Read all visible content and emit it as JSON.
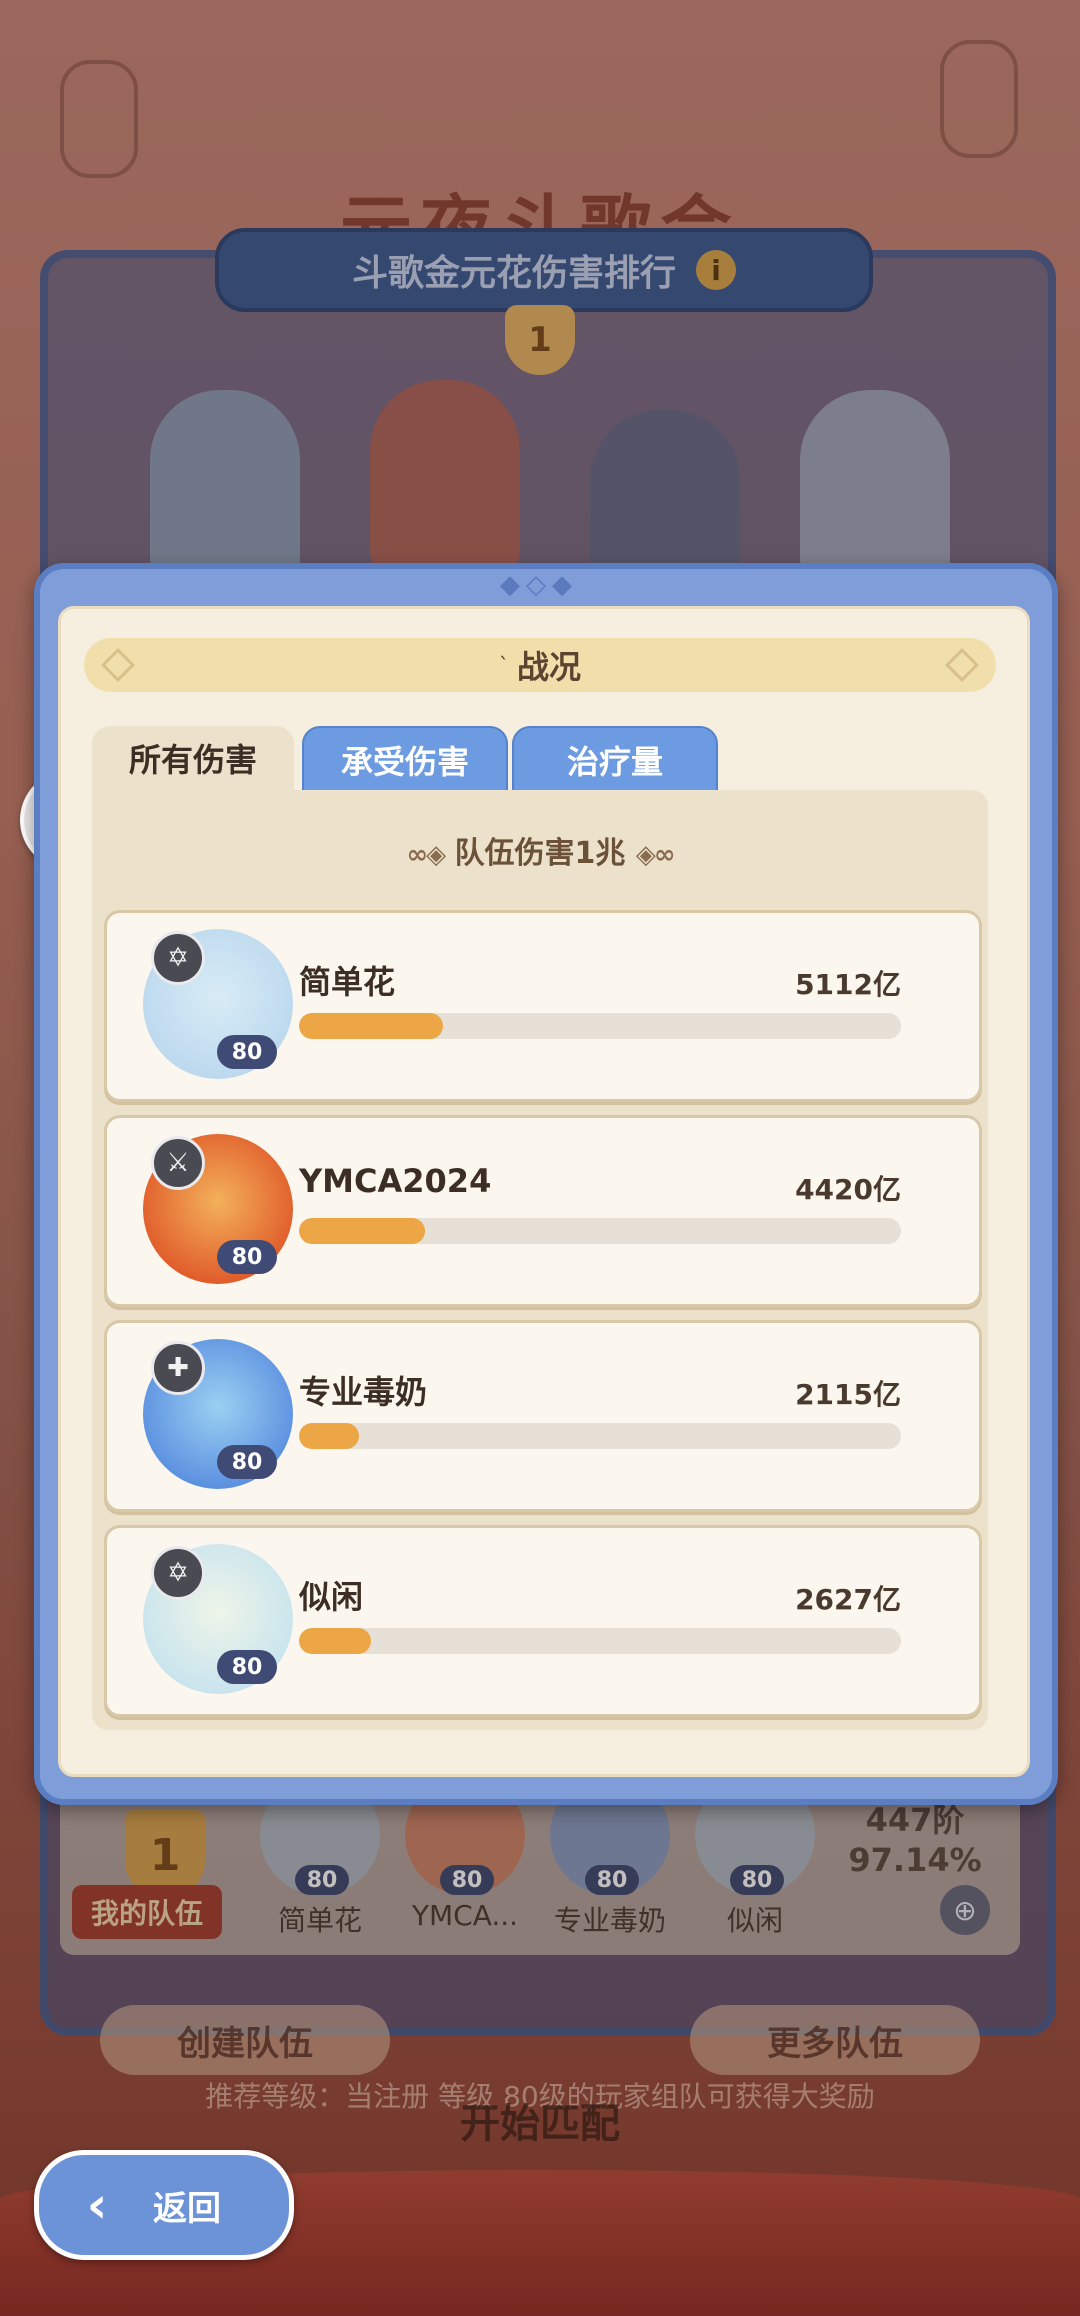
{
  "background": {
    "event_title": "元夜斗歌会",
    "rank_panel_title": "斗歌金元花伤害排行",
    "rank_top_badge": "1",
    "my_team": {
      "rank": "1",
      "label": "我的队伍",
      "tier": "447阶",
      "percent": "97.14%",
      "members": [
        {
          "name": "简单花",
          "level": "80"
        },
        {
          "name": "YMCA...",
          "level": "80"
        },
        {
          "name": "专业毒奶",
          "level": "80"
        },
        {
          "name": "似闲",
          "level": "80"
        }
      ]
    },
    "left_button": "创建队伍",
    "right_button": "更多队伍",
    "hint": "推荐等级：当注册 等级 80级的玩家组队可获得大奖励",
    "start_button": "开始匹配"
  },
  "modal": {
    "title": "战况",
    "tabs": [
      {
        "label": "所有伤害",
        "active": true
      },
      {
        "label": "承受伤害",
        "active": false
      },
      {
        "label": "治疗量",
        "active": false
      }
    ],
    "team_total": "队伍伤害1兆",
    "players": [
      {
        "name": "简单花",
        "level": "80",
        "damage": "5112亿",
        "role_icon": "star-role-icon",
        "progress": 0.24,
        "avatar_colors": [
          "#bcd8ee",
          "#d8ecf6"
        ]
      },
      {
        "name": "YMCA2024",
        "level": "80",
        "damage": "4420亿",
        "role_icon": "sword-role-icon",
        "progress": 0.21,
        "avatar_colors": [
          "#e05a2a",
          "#f3b15a"
        ]
      },
      {
        "name": "专业毒奶",
        "level": "80",
        "damage": "2115亿",
        "role_icon": "cross-role-icon",
        "progress": 0.1,
        "avatar_colors": [
          "#5a8fe0",
          "#9bd0f2"
        ]
      },
      {
        "name": "似闲",
        "level": "80",
        "damage": "2627亿",
        "role_icon": "star-role-icon",
        "progress": 0.12,
        "avatar_colors": [
          "#c8e4ee",
          "#eef5e8"
        ]
      }
    ]
  },
  "back_button": {
    "label": "返回",
    "icon": "back-arrow-icon"
  },
  "chat_icon": "chat-bubble-icon",
  "colors": {
    "progress_fill": "#eda645",
    "tab_inactive": "#6c9be2",
    "modal_frame": "#7f9ed9",
    "level_badge": "#3f4b74"
  }
}
